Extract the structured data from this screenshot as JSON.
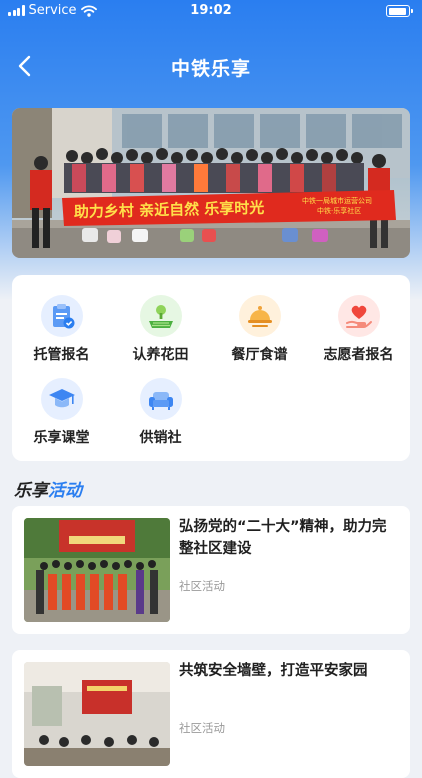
{
  "status_bar": {
    "carrier": "Service",
    "time": "19:02"
  },
  "nav": {
    "title": "中铁乐享"
  },
  "banner": {
    "slogan": "助力乡村  亲近自然  乐享时光",
    "org_line1": "中铁一局城市运营公司",
    "org_line2": "中铁·乐享社区"
  },
  "menu": [
    {
      "label": "托管报名",
      "icon": "clipboard-icon"
    },
    {
      "label": "认养花田",
      "icon": "farm-field-icon"
    },
    {
      "label": "餐厅食谱",
      "icon": "food-dome-icon"
    },
    {
      "label": "志愿者报名",
      "icon": "heart-hand-icon"
    },
    {
      "label": "乐享课堂",
      "icon": "graduation-cap-icon"
    },
    {
      "label": "供销社",
      "icon": "sofa-icon"
    }
  ],
  "section": {
    "title_part1": "乐享",
    "title_part2": "活动"
  },
  "activities": [
    {
      "title": "弘扬党的“二十大”精神，助力完整社区建设",
      "tag": "社区活动"
    },
    {
      "title": "共筑安全墙壁，打造平安家园",
      "tag": "社区活动"
    }
  ],
  "colors": {
    "primary": "#2a7ef0",
    "banner_red": "#e02a1e",
    "slogan_yellow": "#ffe04a"
  }
}
